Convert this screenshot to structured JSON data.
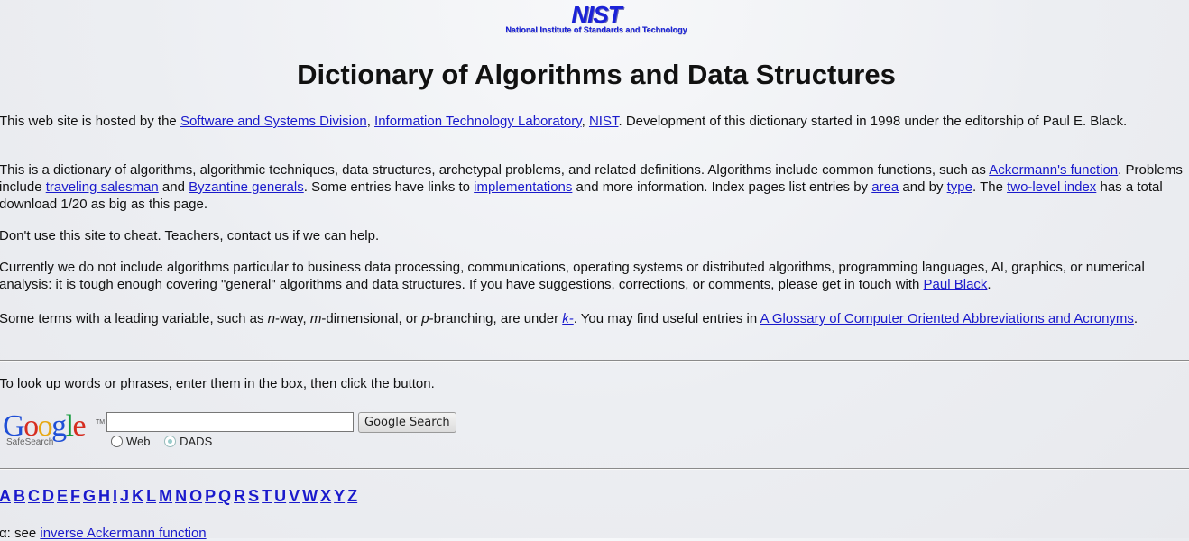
{
  "header": {
    "logo_text": "NIST",
    "logo_subtitle": "National Institute of Standards and Technology",
    "title": "Dictionary of Algorithms and Data Structures"
  },
  "intro": {
    "p1": {
      "t1": "This web site is hosted by the ",
      "link1": "Software and Systems Division",
      "t2": ", ",
      "link2": "Information Technology Laboratory",
      "t3": ", ",
      "link3": "NIST",
      "t4": ". Development of this dictionary started in 1998 under the editorship of Paul E. Black."
    },
    "p2": {
      "t1": "This is a dictionary of algorithms, algorithmic techniques, data structures, archetypal problems, and related definitions. Algorithms include common functions, such as ",
      "link1": "Ackermann's function",
      "t2": ". Problems include ",
      "link2": "traveling salesman",
      "t3": " and ",
      "link3": "Byzantine generals",
      "t4": ". Some entries have links to ",
      "link4": "implementations",
      "t5": " and more information. Index pages list entries by ",
      "link5": "area",
      "t6": " and by ",
      "link6": "type",
      "t7": ". The ",
      "link7": "two-level index",
      "t8": " has a total download 1/20 as big as this page."
    },
    "p3": "Don't use this site to cheat. Teachers, contact us if we can help.",
    "p4": {
      "t1": "Currently we do not include algorithms particular to business data processing, communications, operating systems or distributed algorithms, programming languages, AI, graphics, or numerical analysis: it is tough enough covering \"general\" algorithms and data structures. If you have suggestions, corrections, or comments, please get in touch with ",
      "link1": "Paul Black",
      "t2": "."
    },
    "p5": {
      "t1": "Some terms with a leading variable, such as ",
      "i1": "n",
      "t2": "-way, ",
      "i2": "m",
      "t3": "-dimensional, or ",
      "i3": "p",
      "t4": "-branching, are under ",
      "link1": "k-",
      "t5": ". You may find useful entries in ",
      "link2": "A Glossary of Computer Oriented Abbreviations and Acronyms",
      "t6": "."
    }
  },
  "search": {
    "instructions": "To look up words or phrases, enter them in the box, then click the button.",
    "google_logo": "Google",
    "google_tm": "TM",
    "safesearch": "SafeSearch",
    "input_value": "",
    "button_label": "Google Search",
    "radio_web": "Web",
    "radio_dads": "DADS",
    "selected": "DADS"
  },
  "alphabet": [
    "A",
    "B",
    "C",
    "D",
    "E",
    "F",
    "G",
    "H",
    "I",
    "J",
    "K",
    "L",
    "M",
    "N",
    "O",
    "P",
    "Q",
    "R",
    "S",
    "T",
    "U",
    "V",
    "W",
    "X",
    "Y",
    "Z"
  ],
  "entries": [
    {
      "term": "α",
      "see_text": ": see ",
      "link": "inverse Ackermann function"
    }
  ],
  "colors": {
    "link": "#1a1acc",
    "nist_blue": "#1a22d8",
    "google_blue": "#1f4fd6",
    "google_red": "#d62d20",
    "google_yellow": "#e7a711",
    "google_green": "#129a3a"
  }
}
